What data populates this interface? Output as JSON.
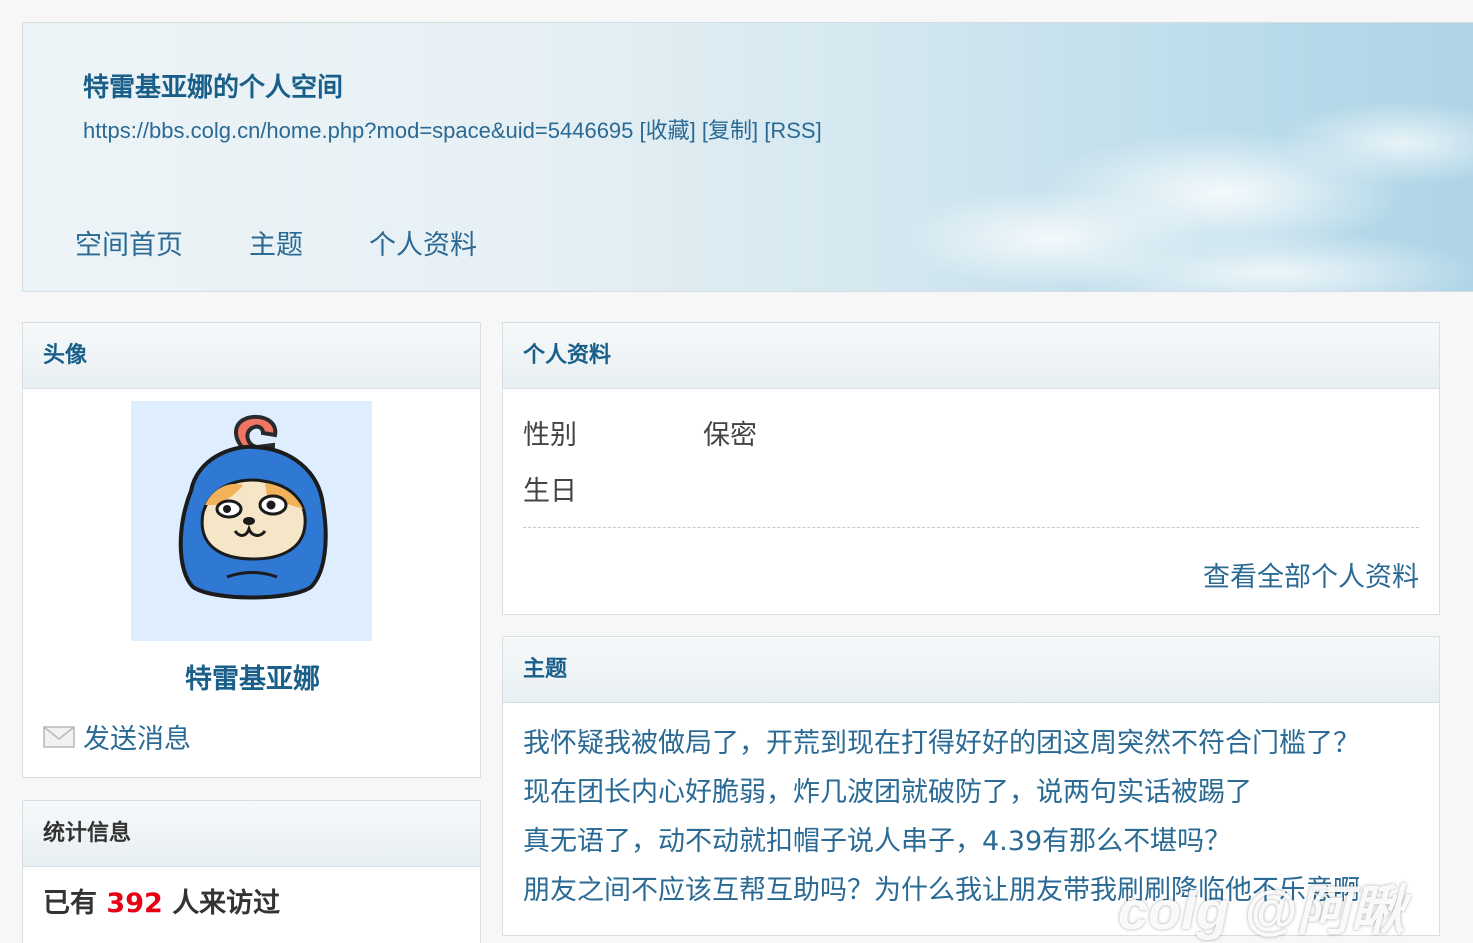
{
  "header": {
    "title": "特雷基亚娜的个人空间",
    "url": "https://bbs.colg.cn/home.php?mod=space&uid=5446695",
    "favorite_label": "[收藏]",
    "copy_label": "[复制]",
    "rss_label": "[RSS]"
  },
  "nav": {
    "items": [
      {
        "label": "空间首页"
      },
      {
        "label": "主题"
      },
      {
        "label": "个人资料"
      }
    ]
  },
  "avatar_panel": {
    "heading": "头像",
    "username": "特雷基亚娜",
    "send_message": "发送消息",
    "icon": "mail-icon"
  },
  "stats_panel": {
    "heading": "统计信息",
    "prefix": "已有",
    "visits": "392",
    "suffix": "人来访过"
  },
  "profile_panel": {
    "heading": "个人资料",
    "fields": [
      {
        "label": "性别",
        "value": "保密"
      },
      {
        "label": "生日",
        "value": ""
      }
    ],
    "view_all": "查看全部个人资料"
  },
  "topics_panel": {
    "heading": "主题",
    "items": [
      "我怀疑我被做局了，开荒到现在打得好好的团这周突然不符合门槛了？",
      "现在团长内心好脆弱，炸几波团就破防了，说两句实话被踢了",
      "真无语了，动不动就扣帽子说人串子，4.39有那么不堪吗？",
      "朋友之间不应该互帮互助吗？为什么我让朋友带我刷刷降临他不乐意啊"
    ]
  },
  "watermark": "colg @阿瞅",
  "colors": {
    "link": "#2a6a94",
    "heading": "#1a5f8a",
    "accent_red": "#e60012"
  }
}
